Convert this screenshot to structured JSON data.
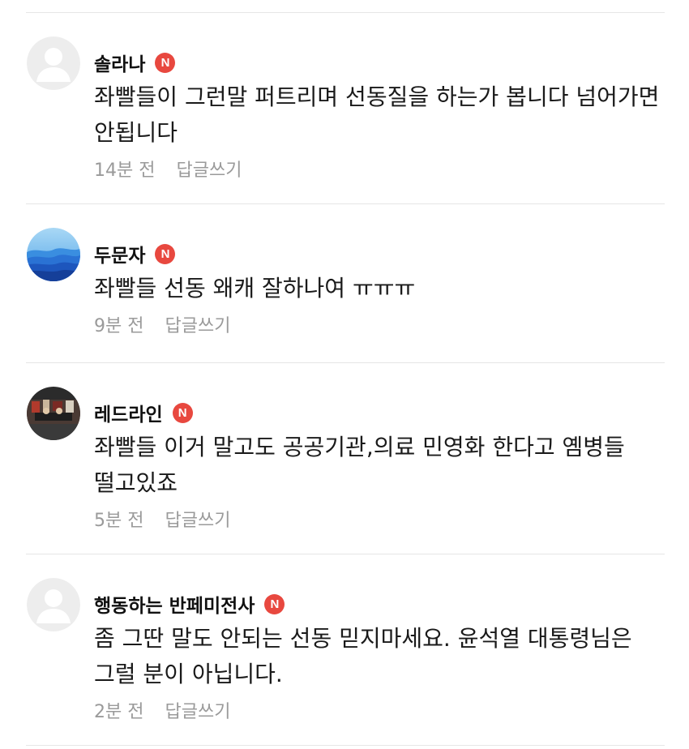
{
  "colors": {
    "badge": "#e8483f",
    "meta_text": "#9a9a9a",
    "divider": "#e6e6e6"
  },
  "comments": [
    {
      "nickname": "솔라나",
      "badge": "N",
      "avatar": "default-avatar-icon",
      "text": "좌빨들이 그런말 퍼트리며 선동질을 하는가 봅니다 넘어가면 안됩니다",
      "time": "14분 전",
      "reply_label": "답글쓰기"
    },
    {
      "nickname": "두문자",
      "badge": "N",
      "avatar": "mountain-avatar-icon",
      "text": "좌빨들 선동 왜캐 잘하나여 ㅠㅠㅠ",
      "time": "9분 전",
      "reply_label": "답글쓰기"
    },
    {
      "nickname": "레드라인",
      "badge": "N",
      "avatar": "photo-avatar-icon",
      "text": "좌빨들 이거 말고도 공공기관,의료 민영화 한다고 옘병들 떨고있죠",
      "time": "5분 전",
      "reply_label": "답글쓰기"
    },
    {
      "nickname": "행동하는 반페미전사",
      "badge": "N",
      "avatar": "default-avatar-icon",
      "text": "좀 그딴 말도 안되는 선동 믿지마세요. 윤석열 대통령님은 그럴 분이 아닙니다.",
      "time": "2분 전",
      "reply_label": "답글쓰기"
    }
  ]
}
